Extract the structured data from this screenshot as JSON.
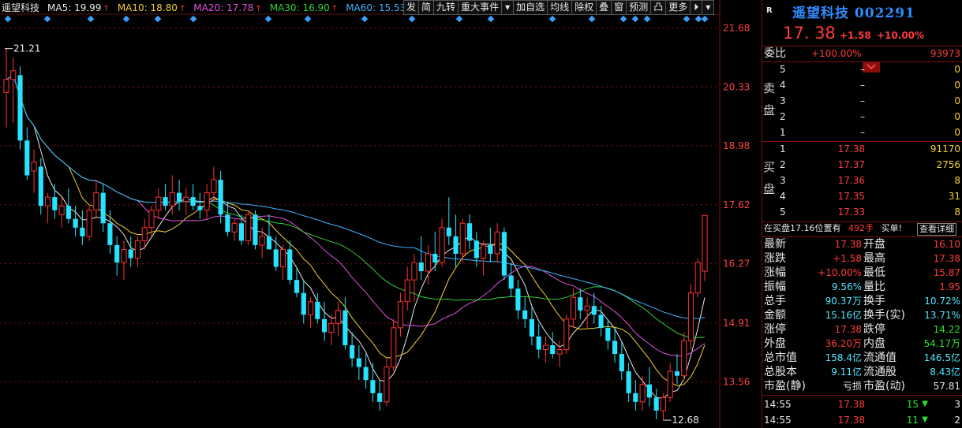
{
  "chart_data": {
    "type": "candlestick",
    "title": "遥望科技",
    "ma_legend": [
      {
        "name": "MA5",
        "value": "19.99",
        "color": "#e8e8e8"
      },
      {
        "name": "MA10",
        "value": "18.80",
        "color": "#f3d031"
      },
      {
        "name": "MA20",
        "value": "17.78",
        "color": "#e052e0"
      },
      {
        "name": "MA30",
        "value": "16.90",
        "color": "#35d035"
      },
      {
        "name": "MA60",
        "value": "15.53",
        "color": "#3fb2ff"
      }
    ],
    "y_ticks": [
      "21.68",
      "20.33",
      "18.98",
      "17.62",
      "16.27",
      "14.91",
      "13.56"
    ],
    "ylim": [
      12.5,
      22.0
    ],
    "annotations": {
      "high_label": "21.21",
      "low_label": "12.68"
    },
    "candles": [
      [
        20.2,
        21.21,
        19.4,
        20.5
      ],
      [
        20.5,
        21.0,
        19.5,
        20.7
      ],
      [
        20.6,
        20.8,
        18.9,
        19.1
      ],
      [
        19.1,
        19.4,
        18.2,
        18.3
      ],
      [
        18.4,
        18.9,
        17.9,
        18.6
      ],
      [
        18.5,
        18.7,
        17.4,
        17.6
      ],
      [
        17.6,
        17.9,
        17.2,
        17.8
      ],
      [
        17.8,
        18.1,
        17.3,
        17.5
      ],
      [
        17.4,
        17.8,
        17.1,
        17.6
      ],
      [
        17.6,
        18.0,
        17.2,
        17.3
      ],
      [
        17.3,
        17.6,
        16.9,
        17.1
      ],
      [
        17.1,
        17.5,
        16.7,
        16.9
      ],
      [
        16.9,
        17.6,
        16.8,
        17.5
      ],
      [
        17.5,
        18.2,
        17.3,
        17.9
      ],
      [
        17.9,
        18.1,
        17.0,
        17.2
      ],
      [
        17.2,
        17.5,
        16.5,
        16.7
      ],
      [
        16.7,
        16.9,
        16.0,
        16.3
      ],
      [
        16.3,
        16.8,
        15.9,
        16.6
      ],
      [
        16.6,
        16.9,
        16.2,
        16.4
      ],
      [
        16.4,
        16.9,
        16.2,
        16.8
      ],
      [
        16.8,
        17.3,
        16.6,
        17.1
      ],
      [
        17.1,
        17.6,
        16.9,
        17.5
      ],
      [
        17.5,
        18.0,
        17.3,
        17.8
      ],
      [
        17.8,
        18.1,
        17.5,
        17.6
      ],
      [
        17.6,
        18.3,
        17.4,
        17.9
      ],
      [
        17.9,
        18.2,
        17.5,
        17.7
      ],
      [
        17.7,
        18.0,
        17.4,
        17.8
      ],
      [
        17.8,
        18.1,
        17.5,
        17.6
      ],
      [
        17.6,
        17.9,
        17.3,
        17.5
      ],
      [
        17.5,
        18.1,
        17.3,
        17.9
      ],
      [
        17.9,
        18.5,
        17.7,
        18.2
      ],
      [
        18.2,
        18.4,
        17.2,
        17.4
      ],
      [
        17.4,
        17.7,
        16.9,
        17.0
      ],
      [
        17.0,
        17.3,
        16.8,
        17.2
      ],
      [
        17.2,
        17.4,
        16.7,
        16.8
      ],
      [
        16.8,
        17.5,
        16.7,
        17.4
      ],
      [
        17.4,
        17.5,
        16.6,
        16.7
      ],
      [
        16.7,
        17.1,
        16.4,
        16.9
      ],
      [
        16.9,
        17.4,
        16.6,
        16.6
      ],
      [
        16.6,
        16.9,
        16.1,
        16.2
      ],
      [
        16.2,
        16.7,
        15.9,
        16.6
      ],
      [
        16.6,
        16.8,
        15.8,
        15.9
      ],
      [
        15.9,
        16.2,
        15.5,
        15.6
      ],
      [
        15.6,
        15.9,
        14.9,
        15.1
      ],
      [
        15.1,
        15.5,
        14.8,
        15.4
      ],
      [
        15.4,
        15.6,
        14.9,
        15.0
      ],
      [
        15.0,
        15.4,
        14.5,
        14.7
      ],
      [
        14.7,
        15.1,
        14.4,
        14.9
      ],
      [
        14.9,
        15.4,
        14.6,
        15.2
      ],
      [
        15.2,
        15.5,
        14.3,
        14.4
      ],
      [
        14.4,
        14.7,
        13.9,
        14.1
      ],
      [
        14.1,
        14.4,
        13.6,
        13.9
      ],
      [
        13.9,
        14.2,
        13.4,
        13.6
      ],
      [
        13.6,
        14.0,
        13.1,
        13.3
      ],
      [
        13.3,
        13.6,
        12.9,
        13.1
      ],
      [
        13.1,
        14.1,
        13.0,
        13.9
      ],
      [
        13.9,
        15.0,
        13.8,
        14.8
      ],
      [
        14.8,
        15.6,
        14.6,
        15.4
      ],
      [
        15.4,
        16.2,
        15.2,
        15.9
      ],
      [
        15.9,
        16.5,
        15.4,
        16.3
      ],
      [
        16.3,
        16.9,
        15.9,
        16.1
      ],
      [
        16.1,
        16.7,
        15.8,
        16.5
      ],
      [
        16.5,
        17.0,
        16.1,
        16.3
      ],
      [
        16.3,
        17.3,
        16.2,
        17.1
      ],
      [
        17.1,
        17.8,
        16.7,
        16.9
      ],
      [
        16.9,
        17.4,
        16.2,
        16.5
      ],
      [
        16.5,
        17.3,
        16.3,
        17.2
      ],
      [
        17.2,
        17.4,
        16.6,
        16.8
      ],
      [
        16.8,
        17.0,
        16.2,
        16.4
      ],
      [
        16.4,
        16.8,
        16.0,
        16.7
      ],
      [
        16.7,
        17.1,
        16.3,
        16.5
      ],
      [
        16.5,
        17.2,
        16.3,
        17.0
      ],
      [
        17.0,
        17.1,
        15.9,
        16.0
      ],
      [
        16.0,
        16.3,
        15.5,
        15.7
      ],
      [
        15.7,
        15.9,
        15.0,
        15.2
      ],
      [
        15.2,
        15.5,
        14.8,
        15.0
      ],
      [
        15.0,
        15.3,
        14.4,
        14.6
      ],
      [
        14.6,
        14.9,
        14.1,
        14.3
      ],
      [
        14.3,
        14.6,
        14.0,
        14.4
      ],
      [
        14.4,
        14.7,
        14.1,
        14.2
      ],
      [
        14.2,
        14.5,
        13.9,
        14.3
      ],
      [
        14.3,
        15.1,
        14.2,
        15.0
      ],
      [
        15.0,
        15.7,
        14.8,
        15.5
      ],
      [
        15.5,
        15.7,
        15.0,
        15.2
      ],
      [
        15.2,
        15.5,
        14.8,
        15.3
      ],
      [
        15.3,
        15.6,
        14.9,
        15.1
      ],
      [
        15.1,
        15.3,
        14.6,
        14.8
      ],
      [
        14.8,
        15.0,
        14.3,
        14.5
      ],
      [
        14.5,
        14.8,
        14.0,
        14.2
      ],
      [
        14.2,
        14.5,
        13.6,
        13.8
      ],
      [
        13.8,
        14.0,
        13.1,
        13.3
      ],
      [
        13.3,
        13.6,
        12.9,
        13.1
      ],
      [
        13.1,
        13.7,
        12.9,
        13.5
      ],
      [
        13.5,
        13.9,
        13.0,
        13.2
      ],
      [
        13.2,
        13.4,
        12.7,
        12.9
      ],
      [
        12.9,
        13.3,
        12.68,
        13.2
      ],
      [
        13.2,
        14.0,
        13.1,
        13.8
      ],
      [
        13.8,
        14.2,
        13.5,
        13.7
      ],
      [
        13.7,
        14.7,
        13.6,
        14.5
      ],
      [
        14.5,
        15.8,
        14.3,
        15.6
      ],
      [
        15.6,
        16.4,
        15.5,
        16.3
      ],
      [
        16.1,
        17.38,
        15.87,
        17.38
      ]
    ]
  },
  "toolbar": [
    "发",
    "简",
    "九转",
    "重大事件",
    "▾",
    "加自选",
    "均线",
    "除权",
    "叠",
    "窗",
    "预测",
    "凸",
    "更多",
    "⏵",
    "▾"
  ],
  "panel": {
    "badge": "R",
    "stock_title": "遥望科技 002291",
    "price": "17. 38",
    "change": "+1.58",
    "change_pct": "+10.00%",
    "weibi_label": "委比",
    "weibi_value": "+100.00%",
    "weibi_diff": "93973",
    "sell_label_1": "卖",
    "sell_label_2": "盘",
    "buy_label_1": "买",
    "buy_label_2": "盘",
    "sell": [
      {
        "level": "5",
        "price": "–",
        "vol": "0"
      },
      {
        "level": "4",
        "price": "–",
        "vol": "0"
      },
      {
        "level": "3",
        "price": "–",
        "vol": "0"
      },
      {
        "level": "2",
        "price": "–",
        "vol": "0"
      },
      {
        "level": "1",
        "price": "–",
        "vol": "0"
      }
    ],
    "buy": [
      {
        "level": "1",
        "price": "17.38",
        "vol": "91170"
      },
      {
        "level": "2",
        "price": "17.37",
        "vol": "2756"
      },
      {
        "level": "3",
        "price": "17.36",
        "vol": "8"
      },
      {
        "level": "4",
        "price": "17.35",
        "vol": "31"
      },
      {
        "level": "5",
        "price": "17.33",
        "vol": "8"
      }
    ],
    "info_bar": {
      "text": "在买盘17.16位置有",
      "vol": "492手",
      "tag": "买单!",
      "link": "查看详细"
    },
    "stats": [
      {
        "l1": "最新",
        "v1": "17.38",
        "c1": "red",
        "l2": "开盘",
        "v2": "16.10",
        "c2": "red"
      },
      {
        "l1": "涨跌",
        "v1": "+1.58",
        "c1": "red",
        "l2": "最高",
        "v2": "17.38",
        "c2": "red"
      },
      {
        "l1": "涨幅",
        "v1": "+10.00%",
        "c1": "red",
        "l2": "最低",
        "v2": "15.87",
        "c2": "red"
      },
      {
        "l1": "振幅",
        "v1": "9.56%",
        "c1": "cyan",
        "l2": "量比",
        "v2": "1.95",
        "c2": "red"
      },
      {
        "l1": "总手",
        "v1": "90.37万",
        "c1": "cyan",
        "l2": "换手",
        "v2": "10.72%",
        "c2": "cyan"
      },
      {
        "l1": "金额",
        "v1": "15.16亿",
        "c1": "cyan",
        "l2": "换手(实)",
        "v2": "13.71%",
        "c2": "cyan"
      },
      {
        "l1": "涨停",
        "v1": "17.38",
        "c1": "red",
        "l2": "跌停",
        "v2": "14.22",
        "c2": "green"
      },
      {
        "l1": "外盘",
        "v1": "36.20万",
        "c1": "red",
        "l2": "内盘",
        "v2": "54.17万",
        "c2": "green"
      },
      {
        "l1": "总市值",
        "v1": "158.4亿",
        "c1": "cyan",
        "l2": "流通值",
        "v2": "146.5亿",
        "c2": "cyan"
      },
      {
        "l1": "总股本",
        "v1": "9.11亿",
        "c1": "cyan",
        "l2": "流通股",
        "v2": "8.43亿",
        "c2": "cyan"
      },
      {
        "l1": "市盈(静)",
        "v1": "亏损",
        "c1": "white",
        "l2": "市盈(动)",
        "v2": "57.81",
        "c2": "white"
      }
    ],
    "ticks": [
      {
        "time": "14:55",
        "price": "17.38",
        "vol": "15",
        "arrow": "▼",
        "count": "3"
      },
      {
        "time": "14:55",
        "price": "17.38",
        "vol": "11",
        "arrow": "▼",
        "count": "2"
      }
    ]
  }
}
